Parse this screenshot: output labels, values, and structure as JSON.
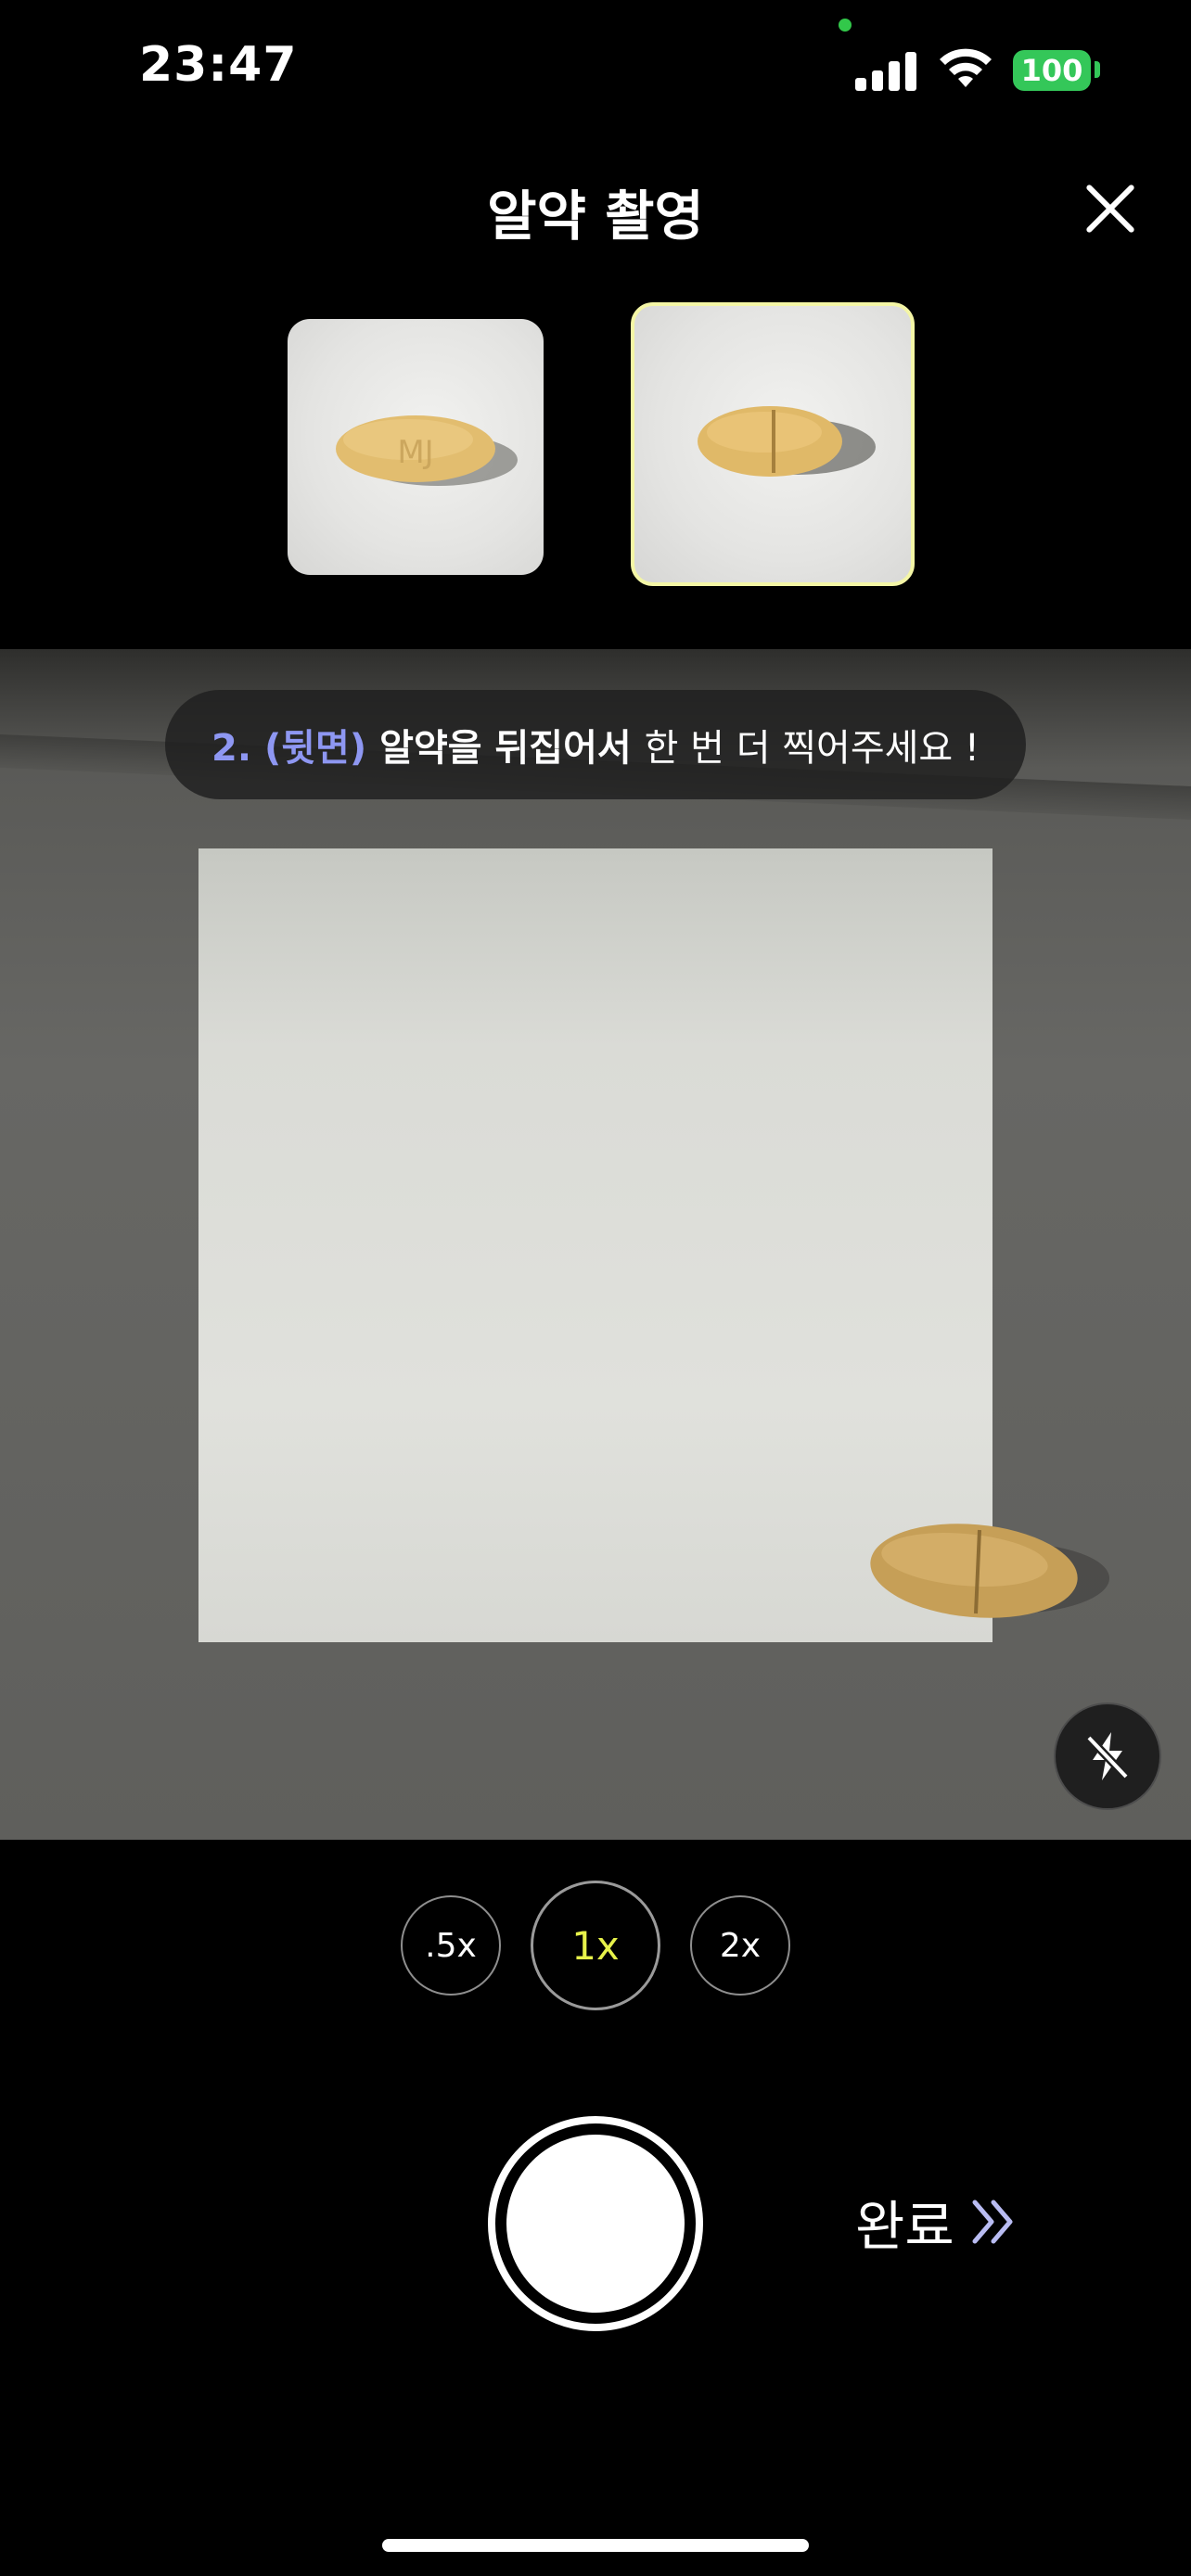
{
  "status_bar": {
    "time": "23:47",
    "battery": "100",
    "camera_indicator_color": "#32c84a",
    "battery_color": "#34c759"
  },
  "header": {
    "title": "알약 촬영",
    "close_icon": "close-icon"
  },
  "thumbnails": [
    {
      "label": "pill-front",
      "imprint": "MJ",
      "selected": false
    },
    {
      "label": "pill-back",
      "imprint": "",
      "selected": true
    }
  ],
  "instruction": {
    "step": "2. (뒷면)",
    "emphasis": "알약을 뒤집어서",
    "rest": "한 번 더 찍어주세요 !",
    "accent_color": "#8e97f2"
  },
  "flash": {
    "icon": "flash-off-icon"
  },
  "zoom": {
    "options": [
      ".5x",
      "1x",
      "2x"
    ],
    "selected": "1x",
    "selected_color": "#e7f24a"
  },
  "done_button": {
    "label": "완료",
    "icon": "double-chevron-right-icon"
  }
}
